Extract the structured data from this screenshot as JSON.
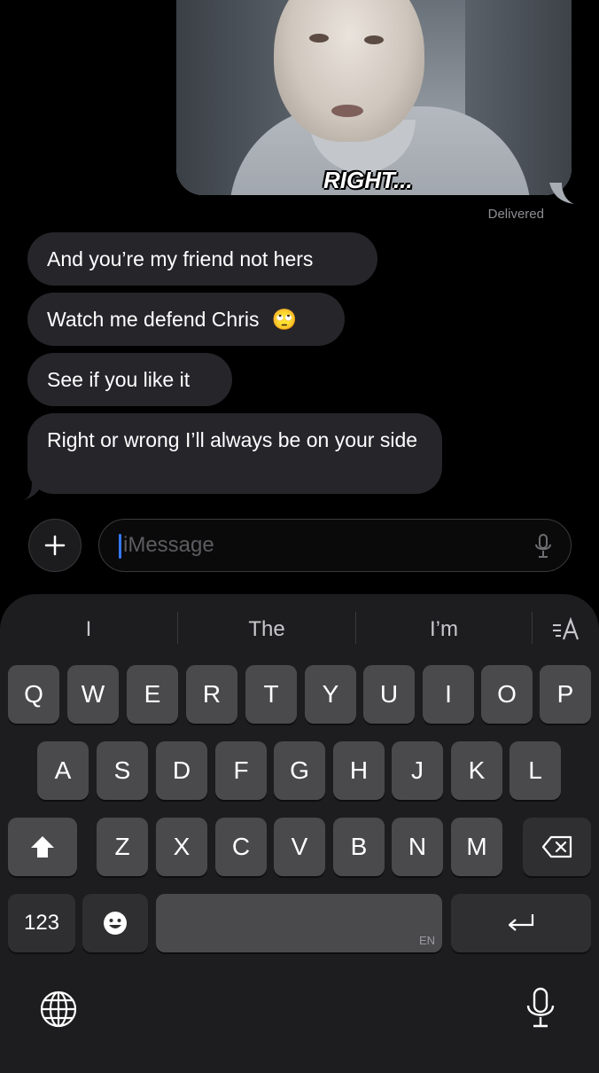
{
  "conversation": {
    "image_caption": "RIGHT...",
    "status": "Delivered",
    "incoming": [
      "And you’re my friend not hers",
      "Watch me defend Chris",
      "See if you like it",
      "Right or wrong I’ll always be on your side"
    ],
    "emoji": "🙄"
  },
  "input": {
    "placeholder": "iMessage",
    "plus_icon": "plus-icon",
    "mic_icon": "microphone-icon"
  },
  "keyboard": {
    "suggestions": [
      "I",
      "The",
      "I’m"
    ],
    "format_icon": "text-format-icon",
    "row1": [
      "Q",
      "W",
      "E",
      "R",
      "T",
      "Y",
      "U",
      "I",
      "O",
      "P"
    ],
    "row2": [
      "A",
      "S",
      "D",
      "F",
      "G",
      "H",
      "J",
      "K",
      "L"
    ],
    "row3": [
      "Z",
      "X",
      "C",
      "V",
      "B",
      "N",
      "M"
    ],
    "numbers_label": "123",
    "space_language": "EN",
    "icons": {
      "shift": "shift-icon",
      "delete": "delete-icon",
      "emoji": "emoji-icon",
      "return": "return-icon",
      "globe": "globe-icon",
      "dictation": "microphone-icon"
    }
  },
  "colors": {
    "bubble_incoming": "#26252a",
    "cursor": "#3478f6",
    "key": "#4a4a4d",
    "background": "#000000"
  }
}
